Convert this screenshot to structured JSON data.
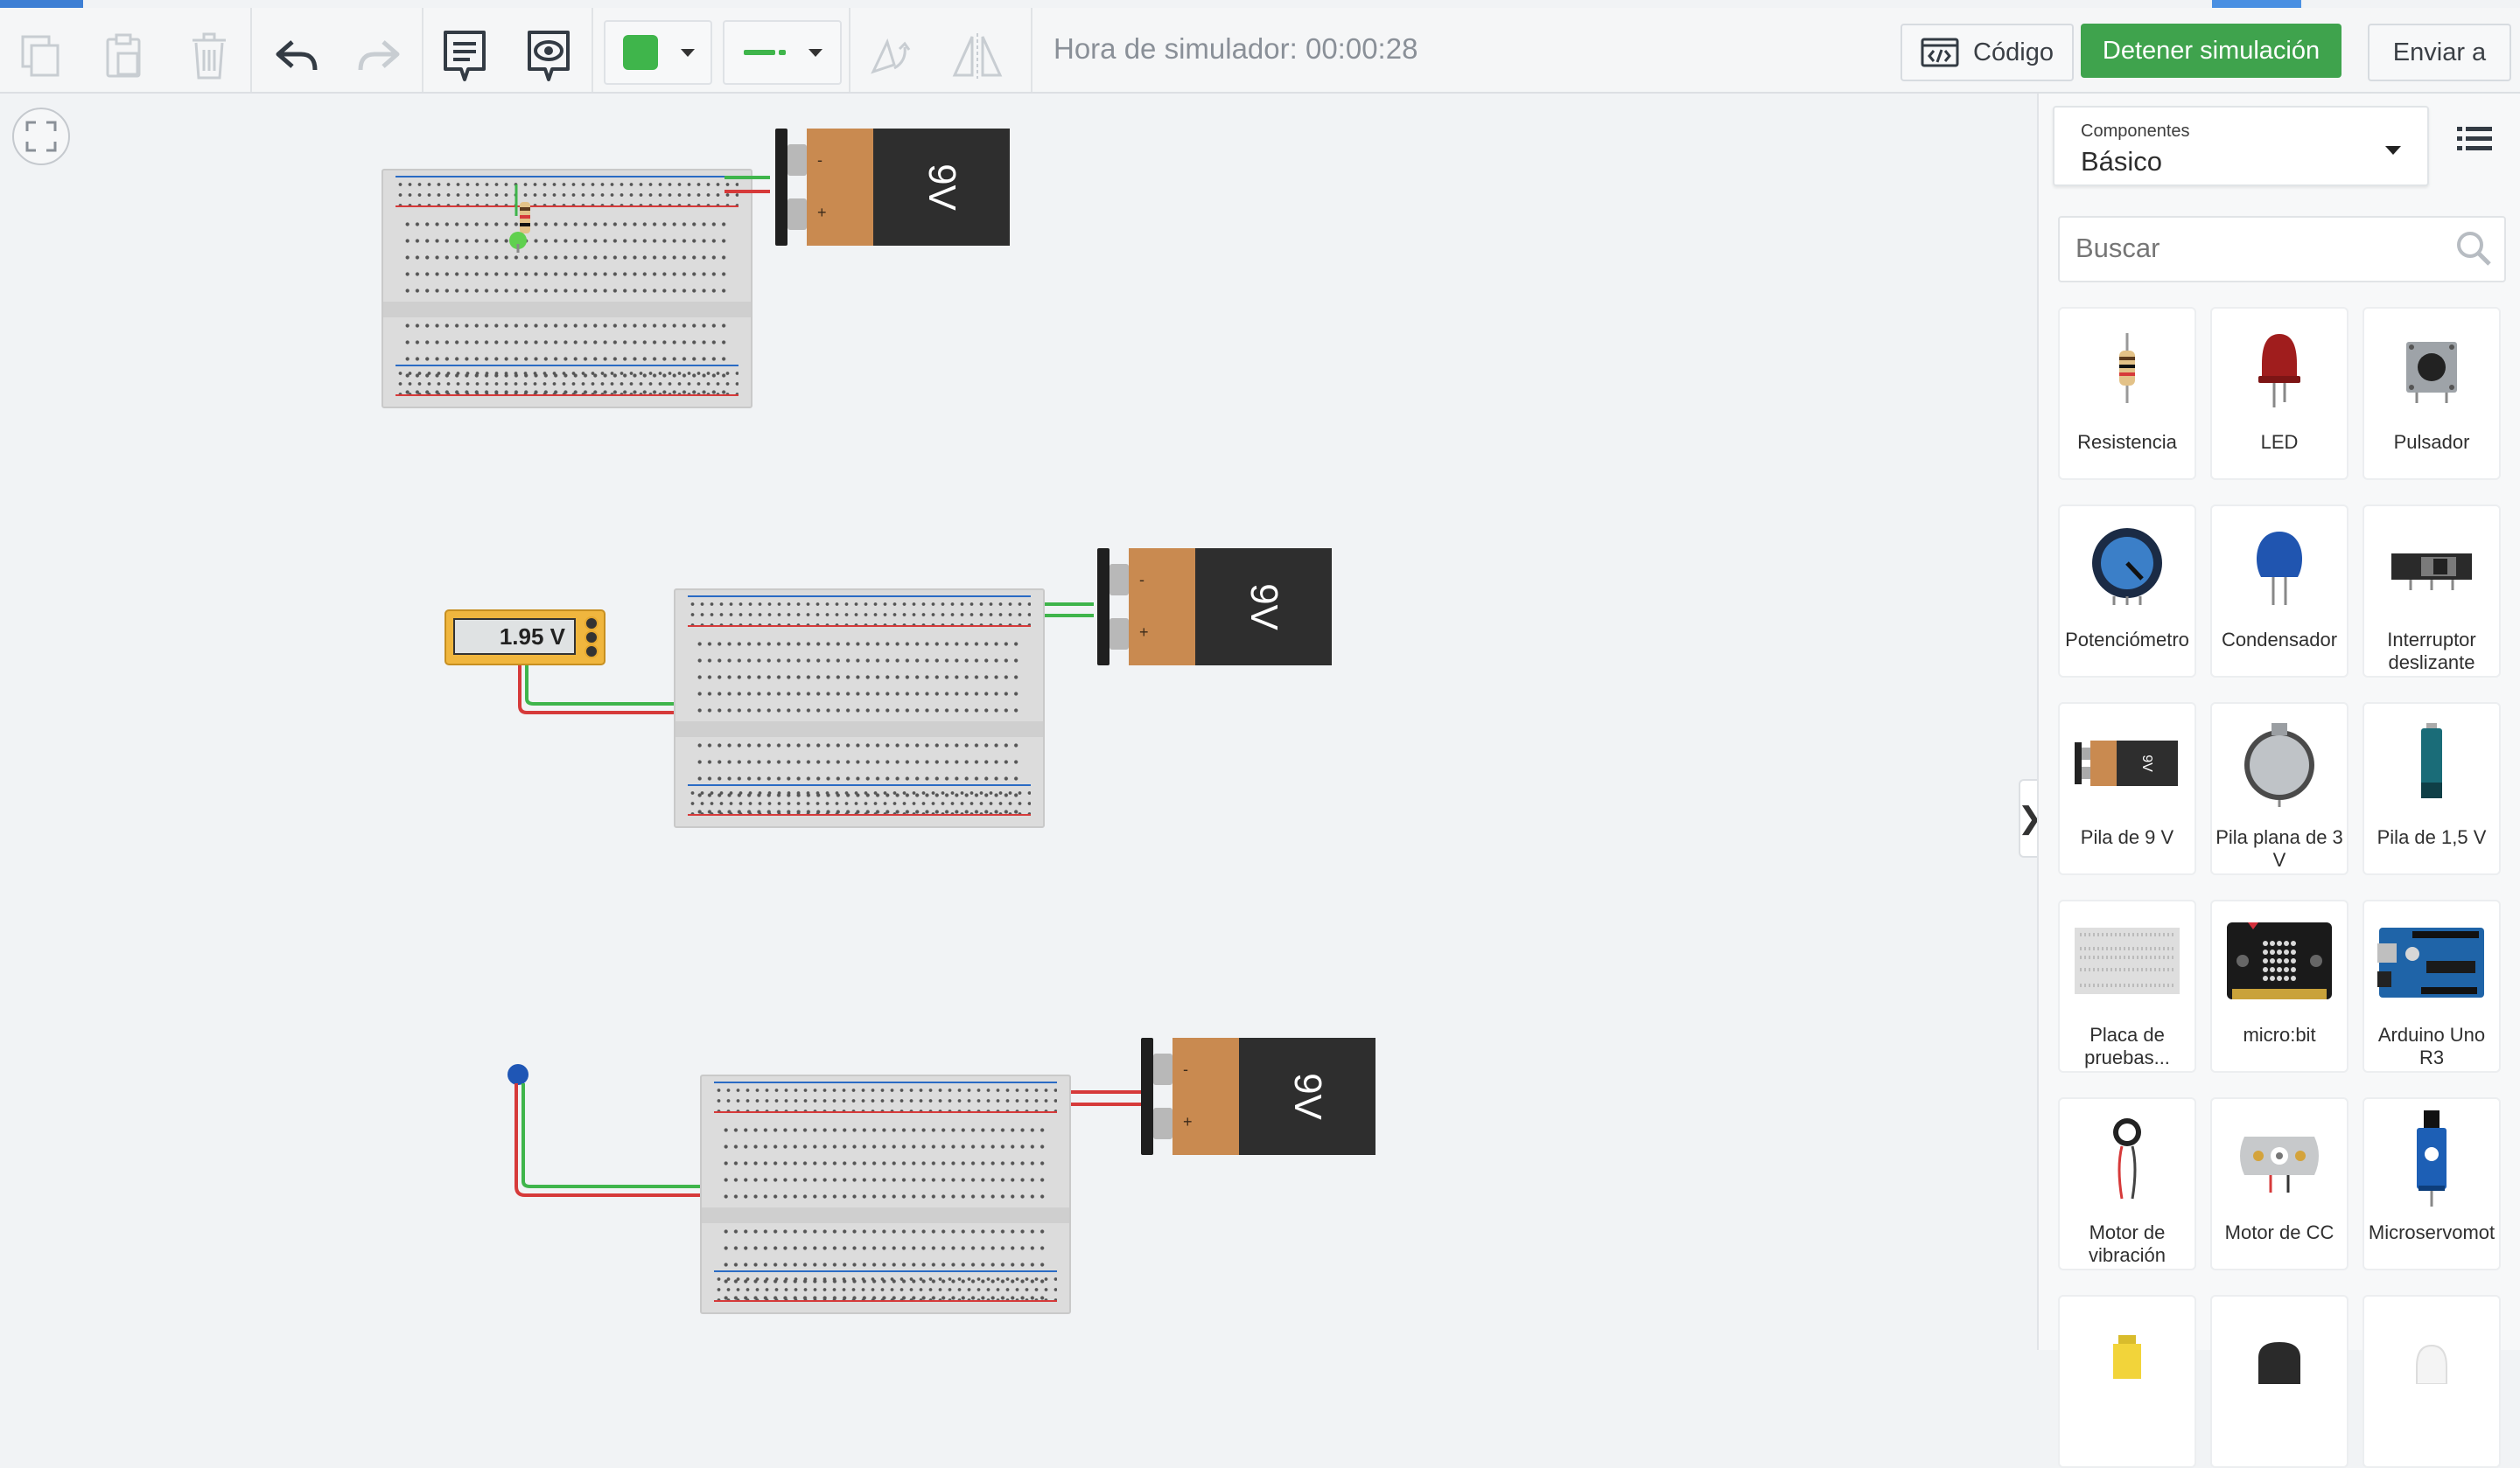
{
  "toolbar": {
    "sim_time": "Hora de simulador: 00:00:28",
    "code_label": "Código",
    "stop_label": "Detener simulación",
    "send_label": "Enviar a",
    "fill_color": "#3fb54b",
    "line_color": "#3fb54b"
  },
  "canvas": {
    "multimeter_reading": "1.95 V",
    "battery_label": "9V",
    "minus": "-",
    "plus": "+"
  },
  "panel": {
    "category_caption": "Componentes",
    "category_value": "Básico",
    "search_placeholder": "Buscar",
    "components": [
      {
        "label": "Resistencia",
        "icon": "resistor-icon"
      },
      {
        "label": "LED",
        "icon": "led-icon"
      },
      {
        "label": "Pulsador",
        "icon": "pushbutton-icon"
      },
      {
        "label": "Potenciómetro",
        "icon": "potentiometer-icon"
      },
      {
        "label": "Condensador",
        "icon": "capacitor-icon"
      },
      {
        "label": "Interruptor deslizante",
        "icon": "slide-switch-icon"
      },
      {
        "label": "Pila de 9 V",
        "icon": "battery-9v-icon"
      },
      {
        "label": "Pila plana de 3 V",
        "icon": "coin-cell-icon"
      },
      {
        "label": "Pila de 1,5 V",
        "icon": "battery-aa-icon"
      },
      {
        "label": "Placa de pruebas...",
        "icon": "breadboard-icon"
      },
      {
        "label": "micro:bit",
        "icon": "microbit-icon"
      },
      {
        "label": "Arduino Uno R3",
        "icon": "arduino-icon"
      },
      {
        "label": "Motor de vibración",
        "icon": "vibration-motor-icon"
      },
      {
        "label": "Motor de CC",
        "icon": "dc-motor-icon"
      },
      {
        "label": "Microservomot",
        "icon": "microservo-icon"
      }
    ]
  }
}
